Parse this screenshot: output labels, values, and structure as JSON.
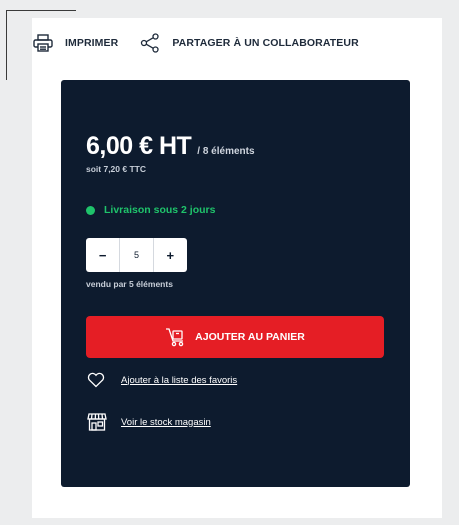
{
  "toolbar": {
    "print_label": "IMPRIMER",
    "share_label": "PARTAGER À UN COLLABORATEUR"
  },
  "product": {
    "price": "6,00 € HT",
    "per_unit": "/ 8 éléments",
    "price_ttc": "soit 7,20 € TTC",
    "delivery": "Livraison sous 2 jours",
    "quantity": "5",
    "decrement_label": "−",
    "increment_label": "+",
    "sold_by": "vendu par 5 éléments",
    "add_to_cart_label": "AJOUTER AU PANIER",
    "favorites_label": "Ajouter à la liste des favoris",
    "stock_label": "Voir le stock magasin"
  },
  "colors": {
    "panel_bg": "#0d1b2e",
    "accent_red": "#e51e25",
    "delivery_green": "#1fc36b"
  },
  "icons": [
    "printer-icon",
    "share-icon",
    "cart-icon",
    "heart-icon",
    "store-icon"
  ]
}
